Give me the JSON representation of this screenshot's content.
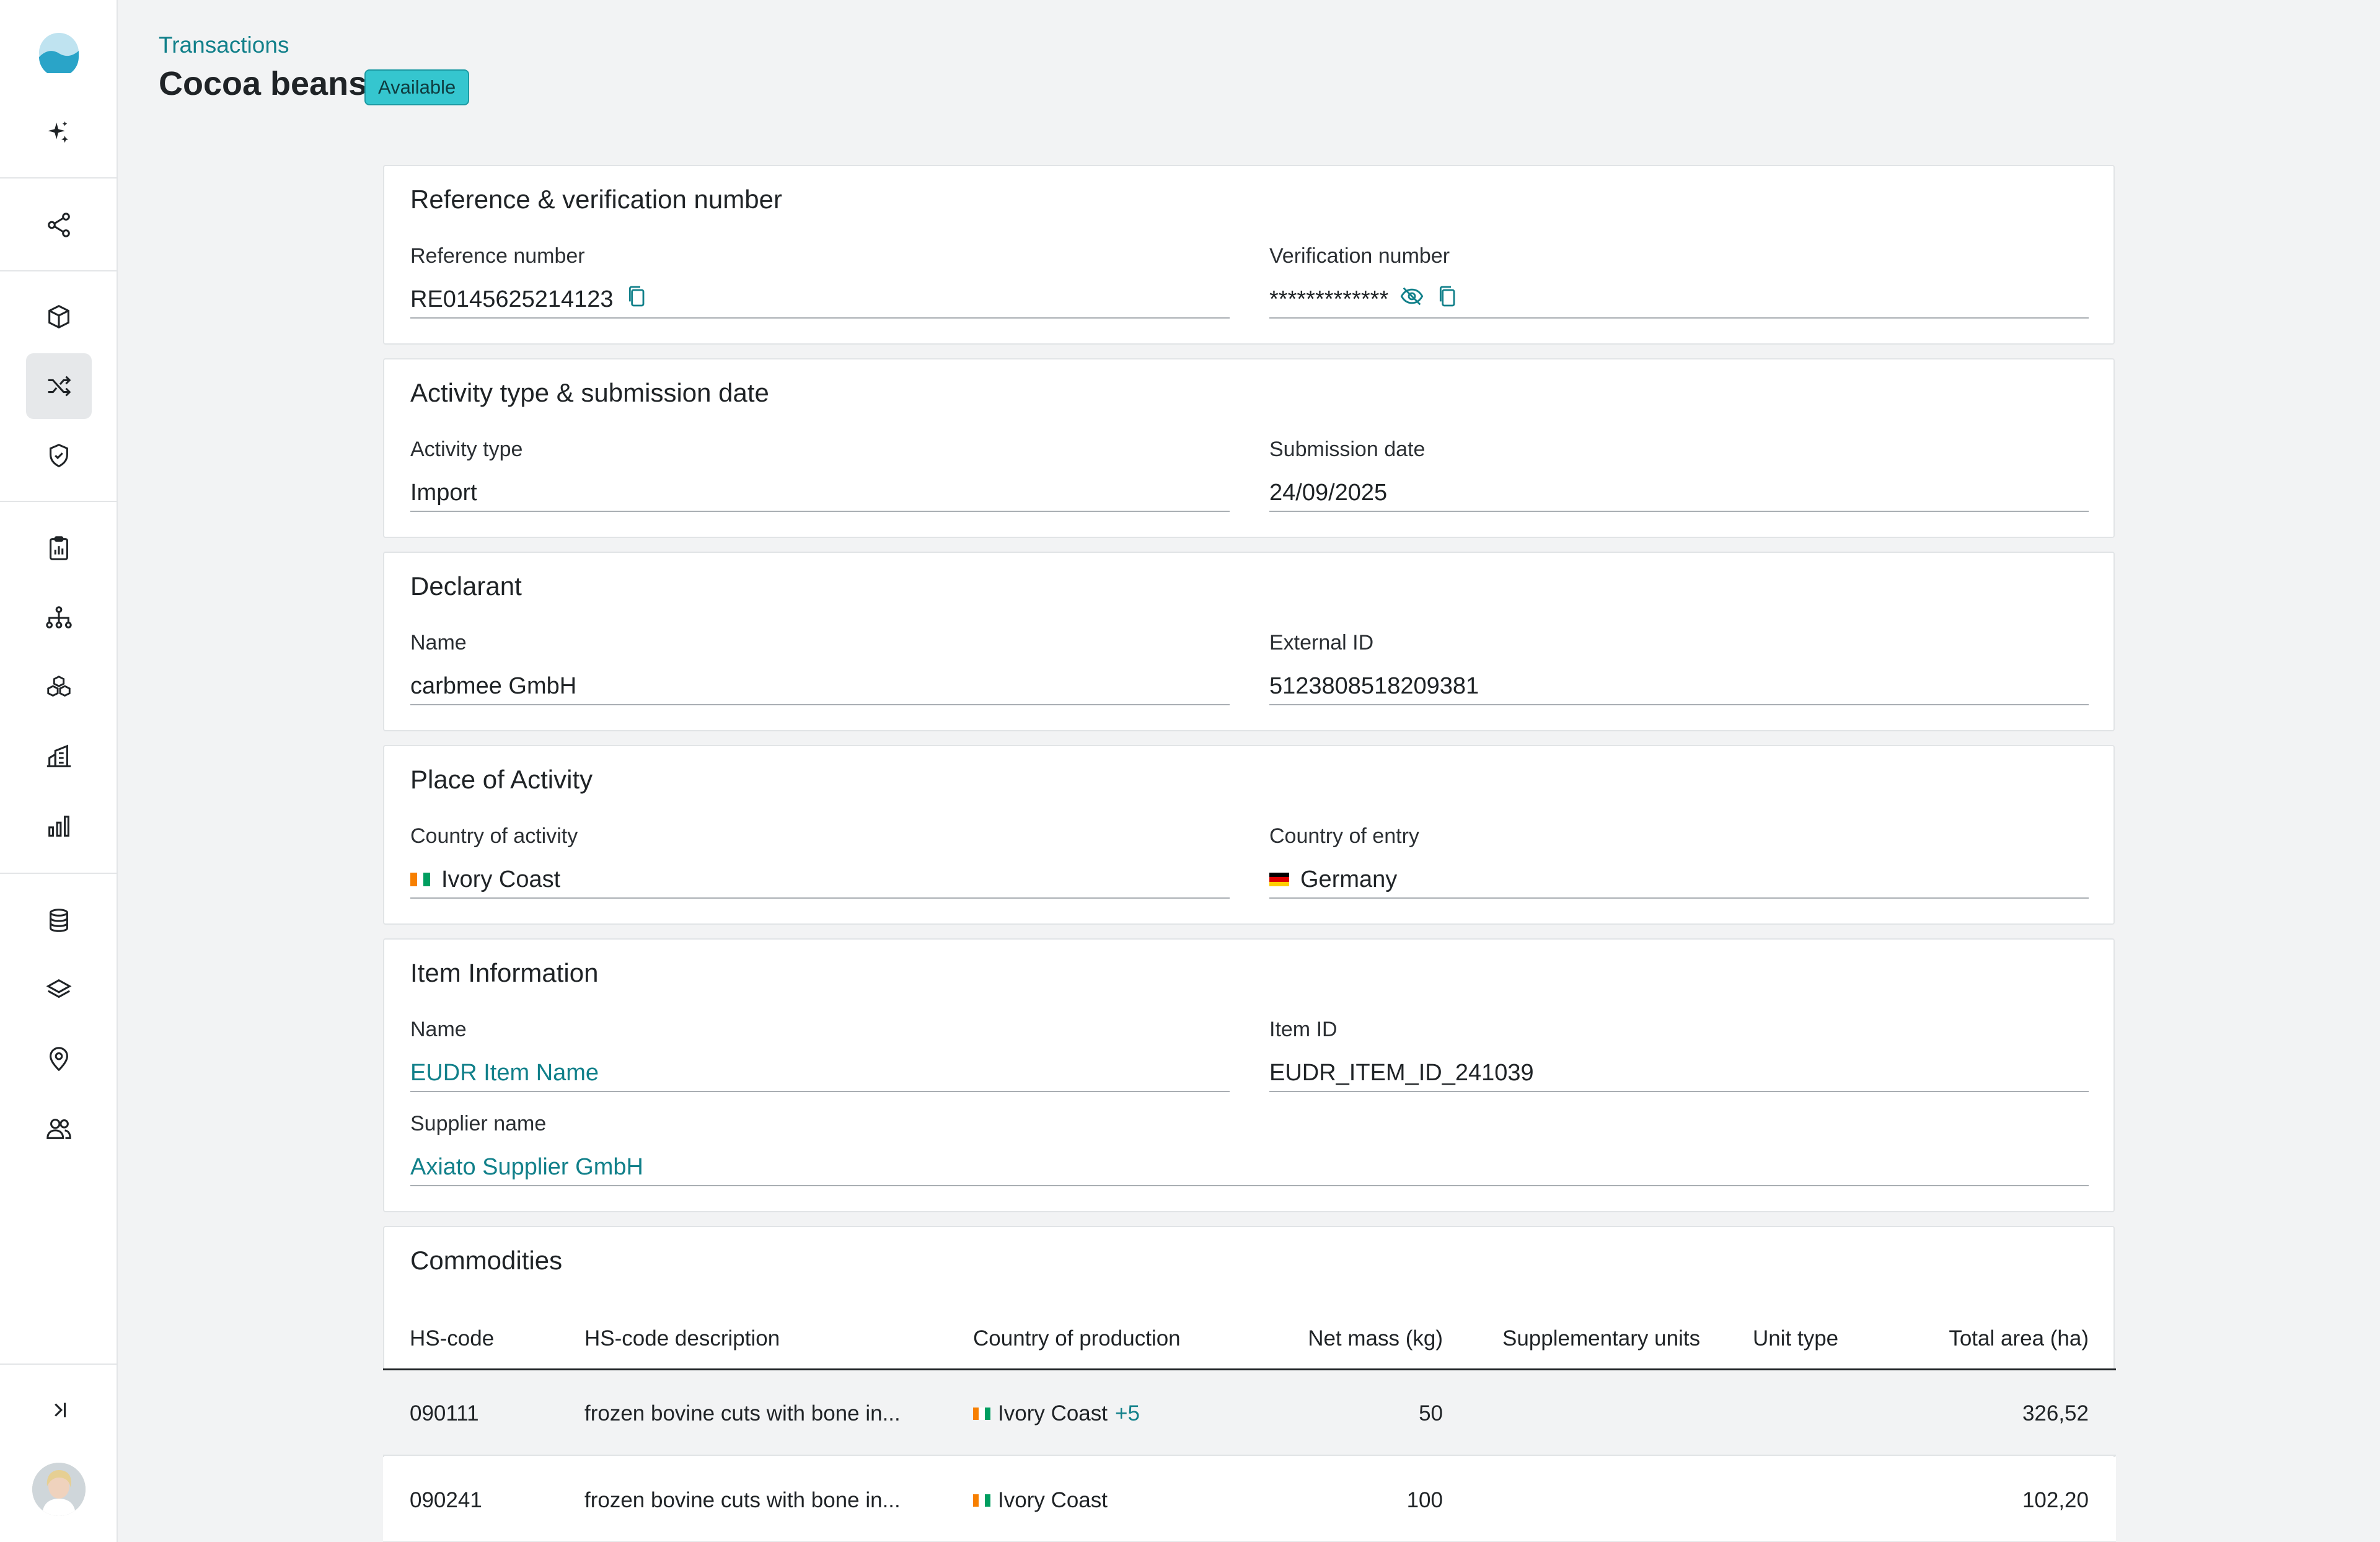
{
  "header": {
    "breadcrumb": "Transactions",
    "title": "Cocoa beans",
    "status": "Available"
  },
  "sidebar": {
    "icons": [
      "sparkle-icon",
      "share-nodes-icon",
      "box-icon",
      "shuffle-icon",
      "shield-check-icon",
      "clipboard-chart-icon",
      "hierarchy-icon",
      "cubes-icon",
      "building-chart-icon",
      "bar-chart-icon",
      "database-icon",
      "layers-icon",
      "location-pin-icon",
      "users-icon",
      "collapse-icon"
    ],
    "active": "shuffle-icon"
  },
  "sections": {
    "reference": {
      "title": "Reference & verification number",
      "ref_label": "Reference number",
      "ref_value": "RE0145625214123",
      "ver_label": "Verification number",
      "ver_value": "*************"
    },
    "activity": {
      "title": "Activity type & submission date",
      "type_label": "Activity type",
      "type_value": "Import",
      "date_label": "Submission date",
      "date_value": "24/09/2025"
    },
    "declarant": {
      "title": "Declarant",
      "name_label": "Name",
      "name_value": "carbmee GmbH",
      "ext_label": "External ID",
      "ext_value": "5123808518209381"
    },
    "place": {
      "title": "Place of Activity",
      "activity_label": "Country of activity",
      "activity_value": "Ivory Coast",
      "entry_label": "Country of entry",
      "entry_value": "Germany"
    },
    "item": {
      "title": "Item Information",
      "name_label": "Name",
      "name_value": "EUDR Item Name",
      "id_label": "Item ID",
      "id_value": "EUDR_ITEM_ID_241039",
      "supplier_label": "Supplier name",
      "supplier_value": "Axiato Supplier GmbH"
    }
  },
  "commodities": {
    "title": "Commodities",
    "columns": [
      "HS-code",
      "HS-code description",
      "Country of production",
      "Net mass (kg)",
      "Supplementary units",
      "Unit type",
      "Total area (ha)"
    ],
    "rows": [
      {
        "hs_code": "090111",
        "description": "frozen bovine cuts with bone in...",
        "country": "Ivory Coast",
        "more": "+5",
        "net_mass": "50",
        "supp_units": "",
        "unit_type": "",
        "total_area": "326,52"
      },
      {
        "hs_code": "090241",
        "description": "frozen bovine cuts with bone in...",
        "country": "Ivory Coast",
        "more": "",
        "net_mass": "100",
        "supp_units": "",
        "unit_type": "",
        "total_area": "102,20"
      }
    ]
  },
  "colors": {
    "accent": "#11808a",
    "badge": "#35c6cf",
    "background": "#f2f3f4"
  }
}
